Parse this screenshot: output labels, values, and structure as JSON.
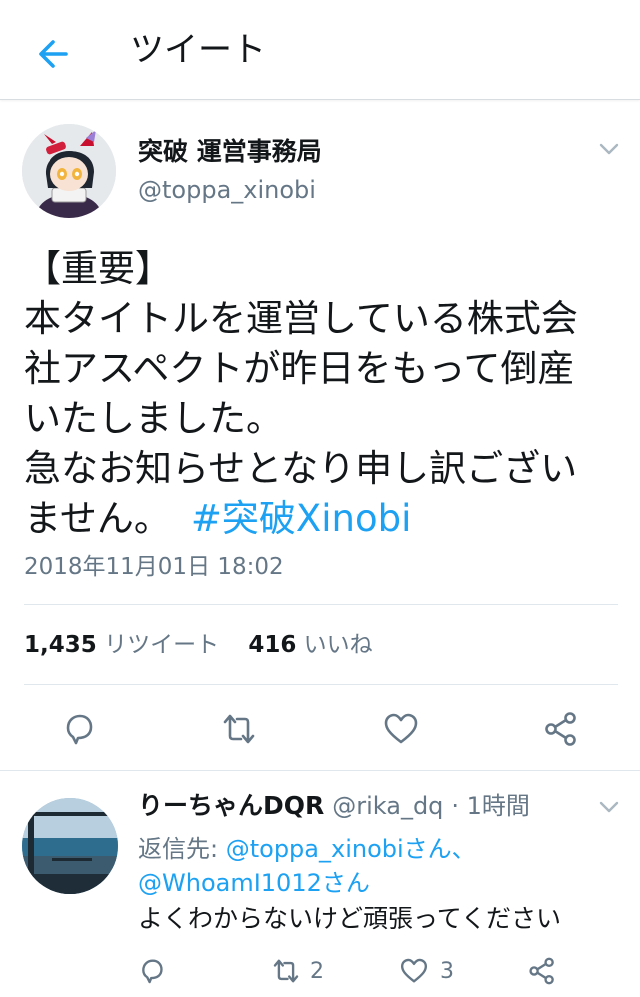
{
  "header": {
    "back_icon": "arrow-left-icon",
    "title": "ツイート"
  },
  "tweet": {
    "author_name": "突破 運営事務局",
    "author_handle": "@toppa_xinobi",
    "text_lines": [
      "【重要】",
      "本タイトルを運営している株式会",
      "社アスペクトが昨日をもって倒産",
      "いたしました。",
      "急なお知らせとなり申し訳ござい",
      "ません。"
    ],
    "hashtag": "#突破Xinobi",
    "timestamp": "2018年11月01日 18:02",
    "retweet_count": "1,435",
    "retweet_label": "リツイート",
    "like_count": "416",
    "like_label": "いいね",
    "actions": [
      "reply-icon",
      "retweet-icon",
      "heart-icon",
      "share-icon"
    ]
  },
  "reply": {
    "author_name": "りーちゃんDQR",
    "author_handle": "@rika_dq",
    "time": "· 1時間",
    "reply_to_label": "返信先: ",
    "mention_1": "@toppa_xinobiさん、",
    "mention_2": "@WhoamI1012さん",
    "text": "よくわからないけど頑張ってください",
    "retweet_count": "2",
    "like_count": "3"
  },
  "colors": {
    "accent": "#1da1f2",
    "secondary_text": "#657786",
    "primary_text": "#14171a",
    "divider": "#e1e8ed"
  }
}
